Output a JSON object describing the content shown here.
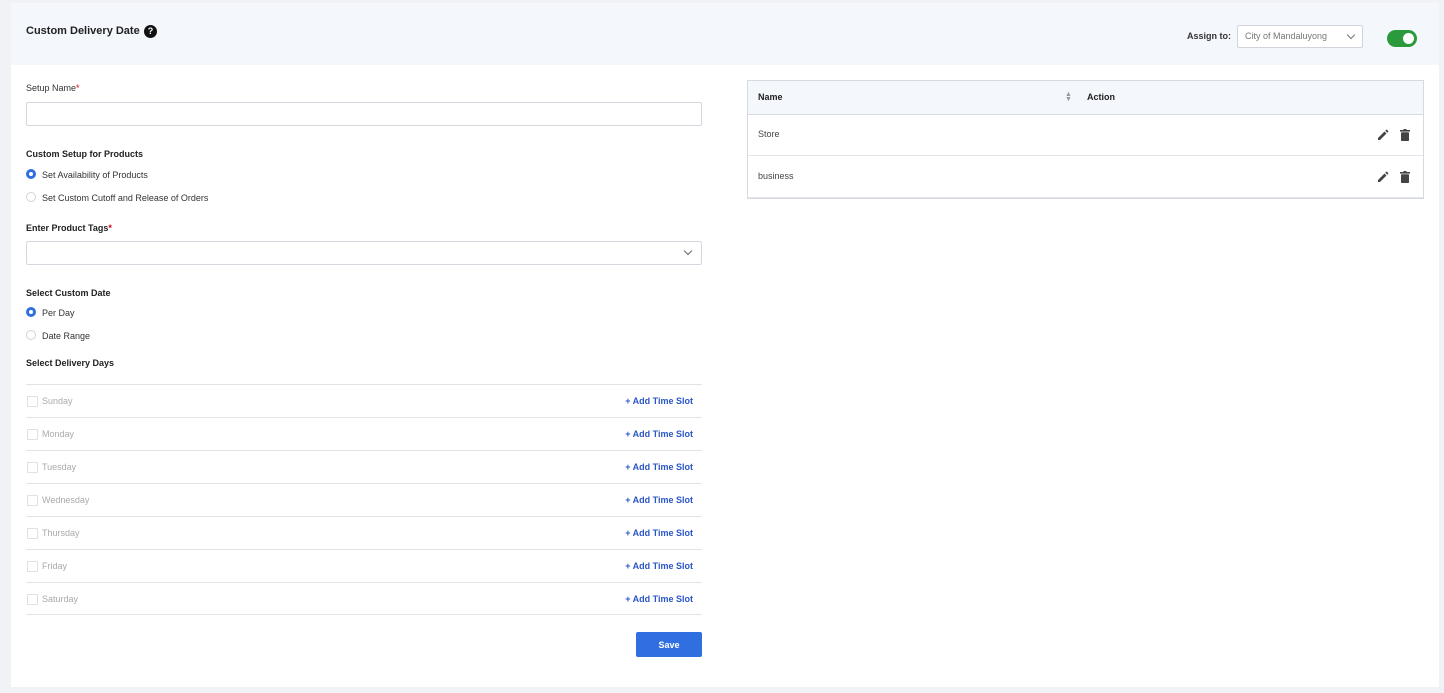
{
  "header": {
    "title": "Custom Delivery Date",
    "help_icon": "?",
    "assign_label": "Assign to:",
    "assign_value": "City of Mandaluyong",
    "toggle_on": true,
    "toggle_color": "#2a9a3c"
  },
  "form": {
    "setup_name_label": "Setup Name",
    "required_mark": "*",
    "setup_name_value": "",
    "custom_setup_label": "Custom Setup for Products",
    "custom_setup_options": [
      "Set Availability of Products",
      "Set Custom Cutoff and Release of Orders"
    ],
    "custom_setup_selected": 0,
    "product_tags_label": "Enter Product Tags",
    "product_tags_value": "",
    "custom_date_label": "Select Custom Date",
    "custom_date_options": [
      "Per Day",
      "Date Range"
    ],
    "custom_date_selected": 0,
    "delivery_days_label": "Select Delivery Days",
    "days": [
      {
        "name": "Sunday",
        "action": "+ Add Time Slot"
      },
      {
        "name": "Monday",
        "action": "+ Add Time Slot"
      },
      {
        "name": "Tuesday",
        "action": "+ Add Time Slot"
      },
      {
        "name": "Wednesday",
        "action": "+ Add Time Slot"
      },
      {
        "name": "Thursday",
        "action": "+ Add Time Slot"
      },
      {
        "name": "Friday",
        "action": "+ Add Time Slot"
      },
      {
        "name": "Saturday",
        "action": "+ Add Time Slot"
      }
    ],
    "save_label": "Save",
    "accent_color": "#2f6fe0"
  },
  "table": {
    "columns": [
      "Name",
      "Action"
    ],
    "rows": [
      {
        "name": "Store"
      },
      {
        "name": "business"
      }
    ]
  }
}
